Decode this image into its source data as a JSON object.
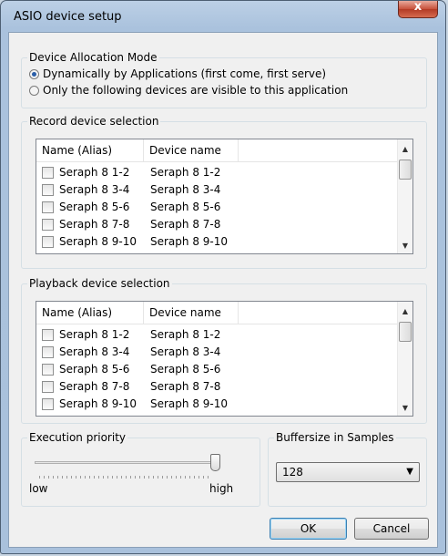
{
  "window": {
    "title": "ASIO device setup",
    "close_label": "x"
  },
  "allocation": {
    "label": "Device Allocation Mode",
    "options": [
      {
        "label": "Dynamically by Applications (first come, first serve)",
        "selected": true
      },
      {
        "label": "Only the following devices are visible to this application",
        "selected": false
      }
    ]
  },
  "record": {
    "label": "Record device selection",
    "columns": [
      "Name (Alias)",
      "Device name"
    ],
    "rows": [
      {
        "alias": "Seraph 8 1-2",
        "device": "Seraph 8 1-2",
        "checked": false
      },
      {
        "alias": "Seraph 8 3-4",
        "device": "Seraph 8 3-4",
        "checked": false
      },
      {
        "alias": "Seraph 8 5-6",
        "device": "Seraph 8 5-6",
        "checked": false
      },
      {
        "alias": "Seraph 8 7-8",
        "device": "Seraph 8 7-8",
        "checked": false
      },
      {
        "alias": "Seraph 8 9-10",
        "device": "Seraph 8 9-10",
        "checked": false
      }
    ]
  },
  "playback": {
    "label": "Playback device selection",
    "columns": [
      "Name (Alias)",
      "Device name"
    ],
    "rows": [
      {
        "alias": "Seraph 8 1-2",
        "device": "Seraph 8 1-2",
        "checked": false
      },
      {
        "alias": "Seraph 8 3-4",
        "device": "Seraph 8 3-4",
        "checked": false
      },
      {
        "alias": "Seraph 8 5-6",
        "device": "Seraph 8 5-6",
        "checked": false
      },
      {
        "alias": "Seraph 8 7-8",
        "device": "Seraph 8 7-8",
        "checked": false
      },
      {
        "alias": "Seraph 8 9-10",
        "device": "Seraph 8 9-10",
        "checked": false
      }
    ]
  },
  "priority": {
    "label": "Execution priority",
    "low_label": "low",
    "high_label": "high",
    "value": 0.97
  },
  "buffersize": {
    "label": "Buffersize in Samples",
    "value": "128"
  },
  "buttons": {
    "ok": "OK",
    "cancel": "Cancel"
  },
  "icons": {
    "radio": "radio-button",
    "checkbox": "checkbox",
    "scroll_up": "chevron-up-icon",
    "scroll_down": "chevron-down-icon",
    "dropdown": "chevron-down-icon"
  }
}
